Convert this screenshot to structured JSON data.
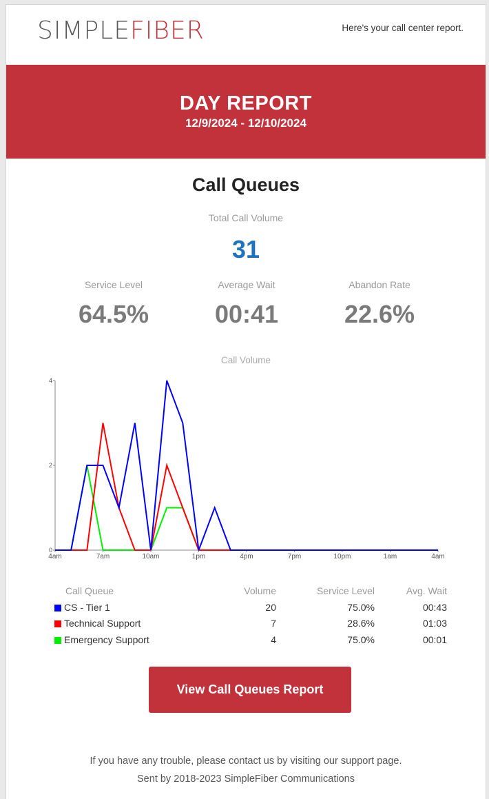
{
  "brand": {
    "part1": "SIMPLE",
    "part2": "FIBER"
  },
  "tagline": "Here's your call center report.",
  "banner": {
    "title": "DAY REPORT",
    "date_range": "12/9/2024 - 12/10/2024"
  },
  "section_title": "Call Queues",
  "total": {
    "label": "Total Call Volume",
    "value": "31"
  },
  "metrics": [
    {
      "label": "Service Level",
      "value": "64.5%"
    },
    {
      "label": "Average Wait",
      "value": "00:41"
    },
    {
      "label": "Abandon Rate",
      "value": "22.6%"
    }
  ],
  "chart_data": {
    "type": "line",
    "title": "Call Volume",
    "x_ticks": [
      "4am",
      "7am",
      "10am",
      "1pm",
      "4pm",
      "7pm",
      "10pm",
      "1am",
      "4am"
    ],
    "y_ticks": [
      "0",
      "2",
      "4"
    ],
    "ylim": [
      0,
      4
    ],
    "xlim": [
      0,
      24
    ],
    "grid": false,
    "series": [
      {
        "name": "CS - Tier 1",
        "color": "#0000ff",
        "x": [
          0,
          1,
          2,
          3,
          4,
          5,
          6,
          7,
          8,
          9,
          10,
          11,
          12,
          13,
          14,
          15,
          16,
          17,
          18,
          19,
          20,
          21,
          22,
          23,
          24
        ],
        "y": [
          0,
          0,
          2,
          2,
          1,
          3,
          0,
          4,
          3,
          0,
          1,
          0,
          0,
          0,
          0,
          0,
          0,
          0,
          0,
          0,
          0,
          0,
          0,
          0,
          0
        ]
      },
      {
        "name": "Technical Support",
        "color": "#ff0000",
        "x": [
          0,
          1,
          2,
          3,
          4,
          5,
          6,
          7,
          8,
          9,
          10,
          11,
          12,
          13,
          14,
          15,
          16,
          17,
          18,
          19,
          20,
          21,
          22,
          23,
          24
        ],
        "y": [
          0,
          0,
          0,
          3,
          1,
          0,
          0,
          2,
          1,
          0,
          0,
          0,
          0,
          0,
          0,
          0,
          0,
          0,
          0,
          0,
          0,
          0,
          0,
          0,
          0
        ]
      },
      {
        "name": "Emergency Support",
        "color": "#00ee00",
        "x": [
          0,
          1,
          2,
          3,
          4,
          5,
          6,
          7,
          8,
          9,
          10,
          11,
          12,
          13,
          14,
          15,
          16,
          17,
          18,
          19,
          20,
          21,
          22,
          23,
          24
        ],
        "y": [
          0,
          0,
          2,
          0,
          0,
          0,
          0,
          1,
          1,
          0,
          0,
          0,
          0,
          0,
          0,
          0,
          0,
          0,
          0,
          0,
          0,
          0,
          0,
          0,
          0
        ]
      }
    ]
  },
  "table": {
    "headers": [
      "Call Queue",
      "Volume",
      "Service Level",
      "Avg. Wait"
    ],
    "rows": [
      {
        "name": "CS - Tier 1",
        "color": "#0000ff",
        "volume": "20",
        "service_level": "75.0%",
        "avg_wait": "00:43"
      },
      {
        "name": "Technical Support",
        "color": "#ff0000",
        "volume": "7",
        "service_level": "28.6%",
        "avg_wait": "01:03"
      },
      {
        "name": "Emergency Support",
        "color": "#00ee00",
        "volume": "4",
        "service_level": "75.0%",
        "avg_wait": "00:01"
      }
    ]
  },
  "button_label": "View Call Queues Report",
  "footer": {
    "line1": "If you have any trouble, please contact us by visiting our support page.",
    "line2": "Sent by 2018-2023 SimpleFiber Communications"
  }
}
